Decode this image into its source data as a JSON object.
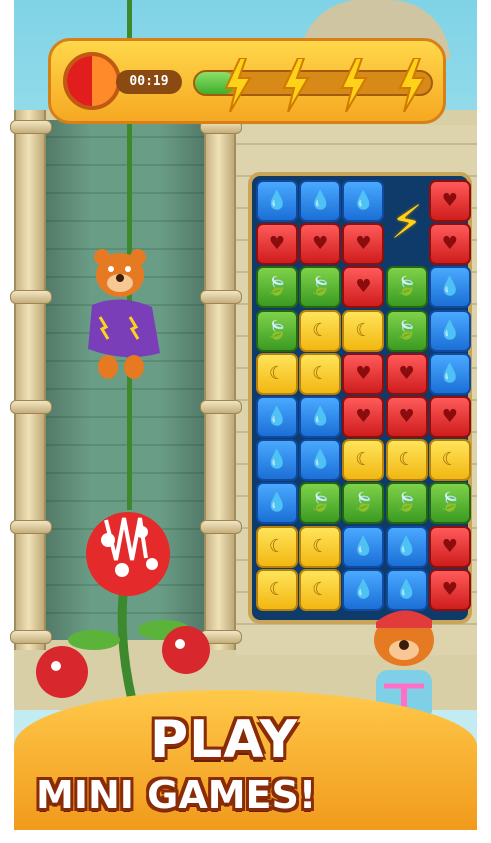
{
  "hud": {
    "timer": "00:19",
    "progress_fraction": 0.17,
    "bolt_count": 4,
    "timer_fraction": 0.5
  },
  "board": {
    "rows": [
      [
        "blue",
        "blue",
        "blue",
        "bolt",
        "red"
      ],
      [
        "red",
        "red",
        "red",
        "bolt",
        "red"
      ],
      [
        "green",
        "green",
        "red",
        "green",
        "blue"
      ],
      [
        "green",
        "yellow",
        "yellow",
        "green",
        "blue"
      ],
      [
        "yellow",
        "yellow",
        "red",
        "red",
        "blue"
      ],
      [
        "blue",
        "blue",
        "red",
        "red",
        "red"
      ],
      [
        "blue",
        "blue",
        "yellow",
        "yellow",
        "yellow"
      ],
      [
        "blue",
        "green",
        "green",
        "green",
        "green"
      ],
      [
        "yellow",
        "yellow",
        "blue",
        "blue",
        "red"
      ],
      [
        "yellow",
        "yellow",
        "blue",
        "blue",
        "red"
      ]
    ],
    "tile_icons": {
      "blue": "💧",
      "red": "♥",
      "green": "🍃",
      "yellow": "☾",
      "bolt": "⚡"
    }
  },
  "promo": {
    "line1": "PLAY",
    "line2": "MINI GAMES!"
  },
  "colors": {
    "banner": "#f5ab2a",
    "text_outline": "#8a2b07",
    "board_frame": "#c9a55a"
  }
}
